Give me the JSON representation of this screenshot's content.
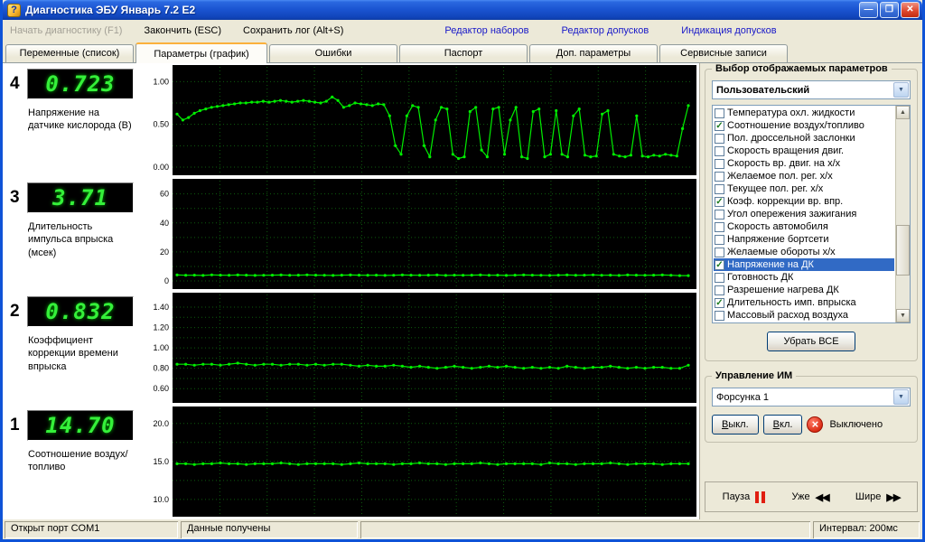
{
  "window": {
    "title": "Диагностика ЭБУ Январь 7.2 E2"
  },
  "titlebar_icons": {
    "app_glyph": "?",
    "minimize": "—",
    "maximize": "❐",
    "close": "✕"
  },
  "toolbar": {
    "start": "Начать диагностику (F1)",
    "stop": "Закончить (ESC)",
    "save_log": "Сохранить лог (Alt+S)",
    "editor_sets": "Редактор наборов",
    "editor_tolerances": "Редактор допусков",
    "tolerance_indication": "Индикация допусков"
  },
  "tabs": [
    {
      "label": "Переменные (список)"
    },
    {
      "label": "Параметры (график)"
    },
    {
      "label": "Ошибки"
    },
    {
      "label": "Паспорт"
    },
    {
      "label": "Доп. параметры"
    },
    {
      "label": "Сервисные записи"
    }
  ],
  "channels": [
    {
      "index": "4",
      "value": "0.723",
      "label": "Напряжение на датчике кислорода (В)"
    },
    {
      "index": "3",
      "value": "3.71",
      "label": "Длительность импульса впрыска (мсек)"
    },
    {
      "index": "2",
      "value": "0.832",
      "label": "Коэффициент коррекции времени впрыска"
    },
    {
      "index": "1",
      "value": "14.70",
      "label": "Соотношение воздух/топливо"
    }
  ],
  "chart_data": [
    {
      "type": "line",
      "title": "Напряжение на датчике кислорода (В)",
      "color": "#00EE00",
      "ylim": [
        0,
        1.12
      ],
      "yticks": [
        {
          "v": 1.0,
          "label": "1.00"
        },
        {
          "v": 0.5,
          "label": "0.50"
        },
        {
          "v": 0.0,
          "label": "0.00"
        }
      ],
      "values": [
        0.62,
        0.55,
        0.58,
        0.63,
        0.66,
        0.68,
        0.7,
        0.71,
        0.72,
        0.73,
        0.74,
        0.75,
        0.75,
        0.76,
        0.76,
        0.77,
        0.76,
        0.77,
        0.78,
        0.77,
        0.76,
        0.77,
        0.78,
        0.77,
        0.76,
        0.75,
        0.77,
        0.82,
        0.78,
        0.7,
        0.72,
        0.75,
        0.74,
        0.73,
        0.72,
        0.74,
        0.73,
        0.6,
        0.25,
        0.15,
        0.6,
        0.72,
        0.7,
        0.25,
        0.12,
        0.55,
        0.7,
        0.68,
        0.15,
        0.1,
        0.12,
        0.65,
        0.7,
        0.2,
        0.12,
        0.68,
        0.7,
        0.15,
        0.55,
        0.7,
        0.12,
        0.1,
        0.65,
        0.68,
        0.12,
        0.15,
        0.66,
        0.15,
        0.12,
        0.6,
        0.68,
        0.14,
        0.12,
        0.13,
        0.62,
        0.66,
        0.15,
        0.13,
        0.12,
        0.14,
        0.6,
        0.13,
        0.12,
        0.14,
        0.13,
        0.15,
        0.14,
        0.13,
        0.45,
        0.72
      ]
    },
    {
      "type": "line",
      "title": "Длительность импульса впрыска (мсек)",
      "color": "#00EE00",
      "ylim": [
        0,
        66
      ],
      "yticks": [
        {
          "v": 60,
          "label": "60"
        },
        {
          "v": 40,
          "label": "40"
        },
        {
          "v": 20,
          "label": "20"
        },
        {
          "v": 0,
          "label": "0"
        }
      ],
      "values": [
        4.1,
        3.9,
        4.0,
        3.8,
        4.2,
        4.0,
        3.9,
        4.1,
        4.0,
        3.8,
        3.9,
        4.0,
        4.1,
        3.9,
        4.0,
        4.2,
        4.0,
        3.9,
        3.8,
        4.0,
        4.1,
        4.0,
        3.9,
        4.0,
        3.8,
        3.9,
        4.1,
        4.0,
        3.9,
        4.0,
        4.1,
        3.8,
        4.0,
        3.9,
        4.0,
        4.1,
        3.9,
        4.0,
        3.8,
        4.0,
        4.1,
        4.0,
        3.9,
        3.8,
        4.0,
        4.1,
        3.9,
        4.0,
        4.2,
        3.9,
        4.0,
        3.8,
        4.1,
        4.0,
        3.9,
        4.0,
        4.1,
        3.9,
        3.7,
        3.7
      ]
    },
    {
      "type": "line",
      "title": "Коэффициент коррекции времени впрыска",
      "color": "#00EE00",
      "ylim": [
        0.54,
        1.48
      ],
      "yticks": [
        {
          "v": 1.4,
          "label": "1.40"
        },
        {
          "v": 1.2,
          "label": "1.20"
        },
        {
          "v": 1.0,
          "label": "1.00"
        },
        {
          "v": 0.8,
          "label": "0.80"
        },
        {
          "v": 0.6,
          "label": "0.60"
        }
      ],
      "values": [
        0.84,
        0.84,
        0.83,
        0.84,
        0.84,
        0.83,
        0.84,
        0.85,
        0.84,
        0.83,
        0.84,
        0.84,
        0.83,
        0.84,
        0.84,
        0.83,
        0.84,
        0.83,
        0.84,
        0.84,
        0.83,
        0.82,
        0.83,
        0.82,
        0.82,
        0.83,
        0.82,
        0.81,
        0.82,
        0.81,
        0.8,
        0.81,
        0.82,
        0.81,
        0.8,
        0.81,
        0.82,
        0.81,
        0.82,
        0.81,
        0.8,
        0.81,
        0.8,
        0.81,
        0.8,
        0.82,
        0.81,
        0.8,
        0.81,
        0.81,
        0.82,
        0.81,
        0.8,
        0.81,
        0.8,
        0.81,
        0.81,
        0.8,
        0.8,
        0.83
      ]
    },
    {
      "type": "line",
      "title": "Соотношение воздух/топливо",
      "color": "#00EE00",
      "ylim": [
        8.8,
        21.4
      ],
      "yticks": [
        {
          "v": 20.0,
          "label": "20.0"
        },
        {
          "v": 15.0,
          "label": "15.0"
        },
        {
          "v": 10.0,
          "label": "10.0"
        }
      ],
      "values": [
        14.7,
        14.7,
        14.6,
        14.7,
        14.7,
        14.8,
        14.7,
        14.7,
        14.6,
        14.7,
        14.7,
        14.7,
        14.8,
        14.7,
        14.6,
        14.7,
        14.7,
        14.7,
        14.7,
        14.6,
        14.7,
        14.8,
        14.7,
        14.7,
        14.7,
        14.6,
        14.7,
        14.7,
        14.8,
        14.7,
        14.7,
        14.6,
        14.7,
        14.7,
        14.7,
        14.8,
        14.7,
        14.6,
        14.7,
        14.7,
        14.7,
        14.7,
        14.6,
        14.8,
        14.7,
        14.7,
        14.6,
        14.7,
        14.7,
        14.7,
        14.8,
        14.7,
        14.6,
        14.7,
        14.7,
        14.7,
        14.6,
        14.7,
        14.7,
        14.7
      ]
    }
  ],
  "right_panel": {
    "param_group": {
      "title": "Выбор отображаемых параметров",
      "preset": "Пользовательский",
      "clear_all": "Убрать ВСЕ",
      "params": [
        {
          "label": "Температура охл. жидкости",
          "checked": false,
          "selected": false
        },
        {
          "label": "Соотношение воздух/топливо",
          "checked": true,
          "selected": false
        },
        {
          "label": "Пол. дроссельной заслонки",
          "checked": false,
          "selected": false
        },
        {
          "label": "Скорость вращения двиг.",
          "checked": false,
          "selected": false
        },
        {
          "label": "Скорость вр. двиг. на х/х",
          "checked": false,
          "selected": false
        },
        {
          "label": "Желаемое пол. рег. х/х",
          "checked": false,
          "selected": false
        },
        {
          "label": "Текущее пол. рег. х/х",
          "checked": false,
          "selected": false
        },
        {
          "label": "Коэф. коррекции вр. впр.",
          "checked": true,
          "selected": false
        },
        {
          "label": "Угол опережения зажигания",
          "checked": false,
          "selected": false
        },
        {
          "label": "Скорость автомобиля",
          "checked": false,
          "selected": false
        },
        {
          "label": "Напряжение бортсети",
          "checked": false,
          "selected": false
        },
        {
          "label": "Желаемые обороты х/х",
          "checked": false,
          "selected": false
        },
        {
          "label": "Напряжение на ДК",
          "checked": true,
          "selected": true
        },
        {
          "label": "Готовность ДК",
          "checked": false,
          "selected": false
        },
        {
          "label": "Разрешение нагрева ДК",
          "checked": false,
          "selected": false
        },
        {
          "label": "Длительность имп. впрыска",
          "checked": true,
          "selected": false
        },
        {
          "label": "Массовый расход воздуха",
          "checked": false,
          "selected": false
        }
      ]
    },
    "control_group": {
      "title": "Управление ИМ",
      "device": "Форсунка 1",
      "off_button": "Выкл.",
      "on_button": "Вкл.",
      "status": "Выключено"
    },
    "playback": {
      "pause": "Пауза",
      "narrower": "Уже",
      "wider": "Шире"
    }
  },
  "status_bar": {
    "port": "Открыт порт COM1",
    "data_status": "Данные получены",
    "interval": "Интервал: 200мс"
  },
  "icons": {
    "dropdown_arrow": "▼",
    "scroll_up": "▲",
    "scroll_down": "▼",
    "check_glyph": "✓",
    "off_cross": "×",
    "narrower_icon": "◀◀",
    "wider_icon": "▶▶"
  }
}
